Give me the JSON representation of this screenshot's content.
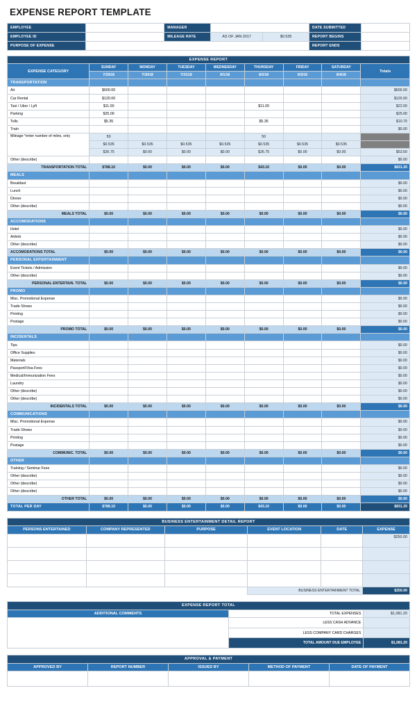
{
  "title": "EXPENSE REPORT TEMPLATE",
  "colors": {
    "dark_navy": "#1f4e79",
    "medium_blue": "#2e75b6",
    "light_blue": "#5b9bd5",
    "pale_blue": "#ddeaf6",
    "subtotal_blue": "#bdd7ee",
    "gray_block": "#808080"
  },
  "info": {
    "employee_label": "EMPLOYEE",
    "employee_value": "",
    "employee_id_label": "EMPLOYEE ID",
    "employee_id_value": "",
    "purpose_label": "PURPOSE OF EXPENSE",
    "purpose_value": "",
    "manager_label": "MANAGER",
    "manager_value": "",
    "mileage_rate_label": "MILEAGE RATE",
    "mileage_rate_asof": "AS OF JAN 2017",
    "mileage_rate_value": "$0.535",
    "date_submitted_label": "DATE SUBMITTED",
    "date_submitted_value": "",
    "report_begins_label": "REPORT BEGINS",
    "report_begins_value": "",
    "report_ends_label": "REPORT ENDS",
    "report_ends_value": ""
  },
  "expense_report": {
    "banner": "EXPENSE REPORT",
    "category_header": "EXPENSE CATEGORY",
    "totals_header": "Totals",
    "days": [
      {
        "name": "SUNDAY",
        "date": "7/29/18"
      },
      {
        "name": "MONDAY",
        "date": "7/30/18"
      },
      {
        "name": "TUESDAY",
        "date": "7/31/18"
      },
      {
        "name": "WEDNESDAY",
        "date": "8/1/18"
      },
      {
        "name": "THURSDAY",
        "date": "8/2/18"
      },
      {
        "name": "FRIDAY",
        "date": "8/3/18"
      },
      {
        "name": "SATURDAY",
        "date": "8/4/18"
      }
    ],
    "sections": [
      {
        "name": "TRANSPORTATION",
        "rows": [
          {
            "label": "Air",
            "values": [
              "$600.00",
              "",
              "",
              "",
              "",
              "",
              ""
            ],
            "total": "$600.00"
          },
          {
            "label": "Car Rental",
            "values": [
              "$120.00",
              "",
              "",
              "",
              "",
              "",
              ""
            ],
            "total": "$120.00"
          },
          {
            "label": "Taxi / Uber / Lyft",
            "values": [
              "$11.00",
              "",
              "",
              "",
              "$11.00",
              "",
              ""
            ],
            "total": "$22.00"
          },
          {
            "label": "Parking",
            "values": [
              "$25.00",
              "",
              "",
              "",
              "",
              "",
              ""
            ],
            "total": "$25.00"
          },
          {
            "label": "Tolls",
            "values": [
              "$5.35",
              "",
              "",
              "",
              "$5.35",
              "",
              ""
            ],
            "total": "$10.70"
          },
          {
            "label": "Train",
            "values": [
              "",
              "",
              "",
              "",
              "",
              "",
              ""
            ],
            "total": "$0.00"
          }
        ],
        "mileage": {
          "label": "Mileage *enter number of miles, only",
          "miles": [
            "50",
            "",
            "",
            "",
            "50",
            "",
            ""
          ],
          "rate": [
            "$0.535",
            "$0.535",
            "$0.535",
            "$0.535",
            "$0.535",
            "$0.535",
            "$0.535"
          ],
          "amount": [
            "$26.75",
            "$0.00",
            "$0.00",
            "$0.00",
            "$26.75",
            "$0.00",
            "$0.00"
          ],
          "amount_total": "$53.50"
        },
        "other_row": {
          "label": "Other (describe)",
          "values": [
            "",
            "",
            "",
            "",
            "",
            "",
            ""
          ],
          "total": "$0.00"
        },
        "total_label": "TRANSPORTATION TOTAL",
        "total_values": [
          "$788.10",
          "$0.00",
          "$0.00",
          "$0.00",
          "$43.10",
          "$0.00",
          "$0.00"
        ],
        "grand_total": "$831.20"
      },
      {
        "name": "MEALS",
        "rows": [
          {
            "label": "Breakfast",
            "values": [
              "",
              "",
              "",
              "",
              "",
              "",
              ""
            ],
            "total": "$0.00"
          },
          {
            "label": "Lunch",
            "values": [
              "",
              "",
              "",
              "",
              "",
              "",
              ""
            ],
            "total": "$0.00"
          },
          {
            "label": "Dinner",
            "values": [
              "",
              "",
              "",
              "",
              "",
              "",
              ""
            ],
            "total": "$0.00"
          },
          {
            "label": "Other (describe)",
            "values": [
              "",
              "",
              "",
              "",
              "",
              "",
              ""
            ],
            "total": "$0.00"
          }
        ],
        "total_label": "MEALS TOTAL",
        "total_values": [
          "$0.00",
          "$0.00",
          "$0.00",
          "$0.00",
          "$0.00",
          "$0.00",
          "$0.00"
        ],
        "grand_total": "$0.00"
      },
      {
        "name": "ACCOMODATIONS",
        "rows": [
          {
            "label": "Hotel",
            "values": [
              "",
              "",
              "",
              "",
              "",
              "",
              ""
            ],
            "total": "$0.00"
          },
          {
            "label": "Airbnb",
            "values": [
              "",
              "",
              "",
              "",
              "",
              "",
              ""
            ],
            "total": "$0.00"
          },
          {
            "label": "Other (describe)",
            "values": [
              "",
              "",
              "",
              "",
              "",
              "",
              ""
            ],
            "total": "$0.00"
          }
        ],
        "total_label": "ACCOMODATIONS TOTAL",
        "total_label_align": "left",
        "total_values": [
          "$0.00",
          "$0.00",
          "$0.00",
          "$0.00",
          "$0.00",
          "$0.00",
          "$0.00"
        ],
        "grand_total": "$0.00"
      },
      {
        "name": "PERSONAL ENTERTAINMENT",
        "rows": [
          {
            "label": "Event Tickets / Admission",
            "values": [
              "",
              "",
              "",
              "",
              "",
              "",
              ""
            ],
            "total": "$0.00"
          },
          {
            "label": "Other (describe)",
            "values": [
              "",
              "",
              "",
              "",
              "",
              "",
              ""
            ],
            "total": "$0.00"
          }
        ],
        "total_label": "PERSONAL ENTERTAIN. TOTAL",
        "total_values": [
          "$0.00",
          "$0.00",
          "$0.00",
          "$0.00",
          "$0.00",
          "$0.00",
          "$0.00"
        ],
        "grand_total": "$0.00"
      },
      {
        "name": "PROMO",
        "rows": [
          {
            "label": "Misc. Promotional Expense",
            "values": [
              "",
              "",
              "",
              "",
              "",
              "",
              ""
            ],
            "total": "$0.00"
          },
          {
            "label": "Trade Shows",
            "values": [
              "",
              "",
              "",
              "",
              "",
              "",
              ""
            ],
            "total": "$0.00"
          },
          {
            "label": "Printing",
            "values": [
              "",
              "",
              "",
              "",
              "",
              "",
              ""
            ],
            "total": "$0.00"
          },
          {
            "label": "Postage",
            "values": [
              "",
              "",
              "",
              "",
              "",
              "",
              ""
            ],
            "total": "$0.00"
          }
        ],
        "total_label": "PROMO TOTAL",
        "total_values": [
          "$0.00",
          "$0.00",
          "$0.00",
          "$0.00",
          "$0.00",
          "$0.00",
          "$0.00"
        ],
        "grand_total": "$0.00"
      },
      {
        "name": "INCIDENTALS",
        "rows": [
          {
            "label": "Tips",
            "values": [
              "",
              "",
              "",
              "",
              "",
              "",
              ""
            ],
            "total": "$0.00"
          },
          {
            "label": "Office Supplies",
            "values": [
              "",
              "",
              "",
              "",
              "",
              "",
              ""
            ],
            "total": "$0.00"
          },
          {
            "label": "Materials",
            "values": [
              "",
              "",
              "",
              "",
              "",
              "",
              ""
            ],
            "total": "$0.00"
          },
          {
            "label": "Passport/Visa Fees",
            "values": [
              "",
              "",
              "",
              "",
              "",
              "",
              ""
            ],
            "total": "$0.00"
          },
          {
            "label": "Medical/Immunization Fees",
            "values": [
              "",
              "",
              "",
              "",
              "",
              "",
              ""
            ],
            "total": "$0.00"
          },
          {
            "label": "Laundry",
            "values": [
              "",
              "",
              "",
              "",
              "",
              "",
              ""
            ],
            "total": "$0.00"
          },
          {
            "label": "Other (describe)",
            "values": [
              "",
              "",
              "",
              "",
              "",
              "",
              ""
            ],
            "total": "$0.00"
          },
          {
            "label": "Other (describe)",
            "values": [
              "",
              "",
              "",
              "",
              "",
              "",
              ""
            ],
            "total": "$0.00"
          }
        ],
        "total_label": "INCIDENTALS TOTAL",
        "total_values": [
          "$0.00",
          "$0.00",
          "$0.00",
          "$0.00",
          "$0.00",
          "$0.00",
          "$0.00"
        ],
        "grand_total": "$0.00"
      },
      {
        "name": "COMMUNICATIONS",
        "rows": [
          {
            "label": "Misc. Promotional Expense",
            "values": [
              "",
              "",
              "",
              "",
              "",
              "",
              ""
            ],
            "total": "$0.00"
          },
          {
            "label": "Trade Shows",
            "values": [
              "",
              "",
              "",
              "",
              "",
              "",
              ""
            ],
            "total": "$0.00"
          },
          {
            "label": "Printing",
            "values": [
              "",
              "",
              "",
              "",
              "",
              "",
              ""
            ],
            "total": "$0.00"
          },
          {
            "label": "Postage",
            "values": [
              "",
              "",
              "",
              "",
              "",
              "",
              ""
            ],
            "total": "$0.00"
          }
        ],
        "total_label": "COMMUNIC. TOTAL",
        "total_values": [
          "$0.00",
          "$0.00",
          "$0.00",
          "$0.00",
          "$0.00",
          "$0.00",
          "$0.00"
        ],
        "grand_total": "$0.00"
      },
      {
        "name": "OTHER",
        "rows": [
          {
            "label": "Training / Seminar Fees",
            "values": [
              "",
              "",
              "",
              "",
              "",
              "",
              ""
            ],
            "total": "$0.00"
          },
          {
            "label": "Other (describe)",
            "values": [
              "",
              "",
              "",
              "",
              "",
              "",
              ""
            ],
            "total": "$0.00"
          },
          {
            "label": "Other (describe)",
            "values": [
              "",
              "",
              "",
              "",
              "",
              "",
              ""
            ],
            "total": "$0.00"
          },
          {
            "label": "Other (describe)",
            "values": [
              "",
              "",
              "",
              "",
              "",
              "",
              ""
            ],
            "total": "$0.00"
          }
        ],
        "total_label": "OTHER TOTAL",
        "total_values": [
          "$0.00",
          "$0.00",
          "$0.00",
          "$0.00",
          "$0.00",
          "$0.00",
          "$0.00"
        ],
        "grand_total": "$0.00"
      }
    ],
    "total_per_day_label": "TOTAL PER DAY",
    "total_per_day_values": [
      "$788.10",
      "$0.00",
      "$0.00",
      "$0.00",
      "$43.10",
      "$0.00",
      "$0.00"
    ],
    "total_per_day_grand": "$831.20"
  },
  "business_entertainment": {
    "banner": "BUSINESS ENTERTAINMENT DETAIL REPORT",
    "headers": [
      "PERSONS ENTERTAINED",
      "COMPANY REPRESENTED",
      "PURPOSE",
      "EVENT LOCATION",
      "DATE",
      "EXPENSE"
    ],
    "rows": [
      {
        "persons": "",
        "company": "",
        "purpose": "",
        "location": "",
        "date": "",
        "expense": "$250.00"
      },
      {
        "persons": "",
        "company": "",
        "purpose": "",
        "location": "",
        "date": "",
        "expense": ""
      },
      {
        "persons": "",
        "company": "",
        "purpose": "",
        "location": "",
        "date": "",
        "expense": ""
      },
      {
        "persons": "",
        "company": "",
        "purpose": "",
        "location": "",
        "date": "",
        "expense": ""
      }
    ],
    "total_label": "BUSINESS ENTERTAINMENT TOTAL",
    "total_value": "$250.00"
  },
  "expense_report_total": {
    "banner": "EXPENSE REPORT TOTAL",
    "comments_header": "ADDITIONAL COMMENTS",
    "comments_value": "",
    "lines": [
      {
        "label": "TOTAL EXPENSES",
        "value": "$1,081.20"
      },
      {
        "label": "LESS CASH ADVANCE",
        "value": ""
      },
      {
        "label": "LESS COMPANY CARD CHARGES",
        "value": ""
      }
    ],
    "final_label": "TOTAL AMOUNT DUE EMPLOYEE",
    "final_value": "$1,081.20"
  },
  "approval": {
    "banner": "APPROVAL & PAYMENT",
    "headers": [
      "APPROVED BY",
      "REPORT NUMBER",
      "ISSUED BY",
      "METHOD OF PAYMENT",
      "DATE OF PAYMENT"
    ],
    "values": [
      "",
      "",
      "",
      "",
      ""
    ]
  }
}
